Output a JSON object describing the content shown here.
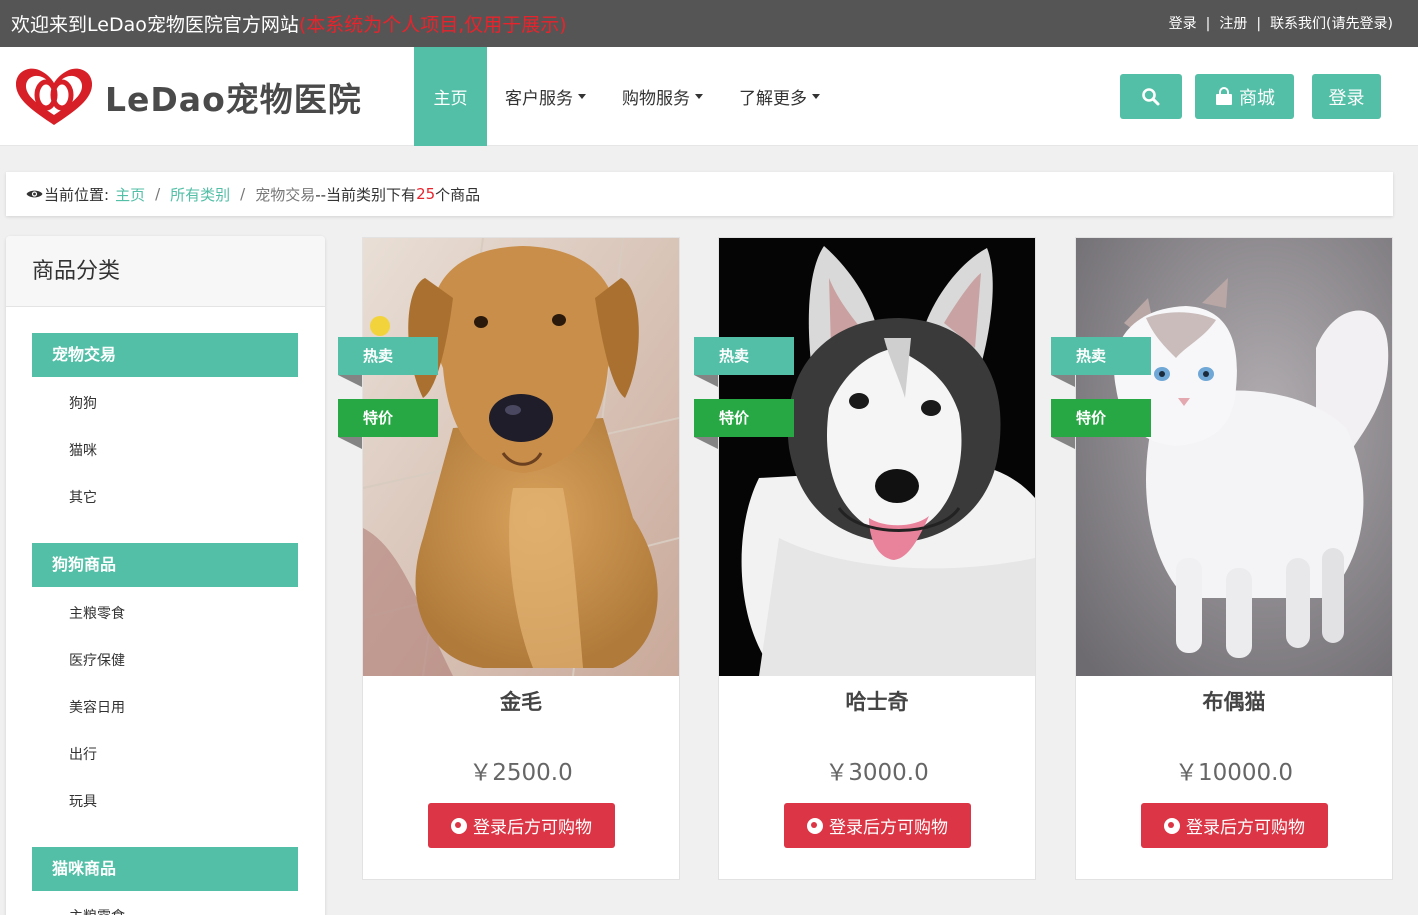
{
  "topbar": {
    "welcome": "欢迎来到LeDao宠物医院官方网站",
    "note": "(本系统为个人项目,仅用于展示)",
    "links": [
      "登录",
      "注册",
      "联系我们(请先登录)"
    ],
    "separator": "|"
  },
  "header": {
    "logo_text": "LeDao宠物医院",
    "nav": [
      {
        "label": "主页",
        "active": true,
        "dropdown": false
      },
      {
        "label": "客户服务",
        "active": false,
        "dropdown": true
      },
      {
        "label": "购物服务",
        "active": false,
        "dropdown": true
      },
      {
        "label": "了解更多",
        "active": false,
        "dropdown": true
      }
    ],
    "search_icon": "search-icon",
    "shop_label": "商城",
    "shop_icon": "shopping-bag-icon",
    "login_label": "登录"
  },
  "breadcrumb": {
    "prefix": "当前位置:",
    "eye_icon": "eye-icon",
    "home": "主页",
    "all": "所有类别",
    "current": "宠物交易",
    "text_before": "--当前类别下有",
    "count": "25",
    "text_after": "个商品",
    "separator": "/"
  },
  "sidebar": {
    "title": "商品分类",
    "groups": [
      {
        "label": "宠物交易",
        "items": [
          "狗狗",
          "猫咪",
          "其它"
        ]
      },
      {
        "label": "狗狗商品",
        "items": [
          "主粮零食",
          "医疗保健",
          "美容日用",
          "出行",
          "玩具"
        ]
      },
      {
        "label": "猫咪商品",
        "items": [
          "主粮零食"
        ]
      }
    ]
  },
  "ribbons": {
    "hot": "热卖",
    "special": "特价"
  },
  "products": [
    {
      "name": "金毛",
      "price": "￥2500.0",
      "button": "登录后方可购物",
      "photo": "golden-retriever-photo"
    },
    {
      "name": "哈士奇",
      "price": "￥3000.0",
      "button": "登录后方可购物",
      "photo": "husky-photo"
    },
    {
      "name": "布偶猫",
      "price": "￥10000.0",
      "button": "登录后方可购物",
      "photo": "ragdoll-cat-photo"
    }
  ],
  "colors": {
    "accent": "#52bfa6",
    "danger": "#dc3545",
    "success": "#28a745",
    "topbar": "#555555",
    "note": "#e8232b"
  }
}
